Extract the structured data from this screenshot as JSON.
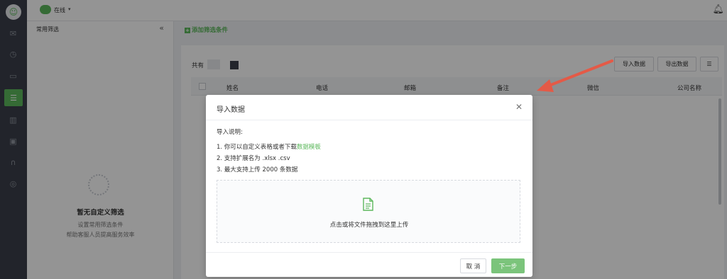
{
  "topbar": {
    "status": "在线"
  },
  "filter_panel": {
    "title": "常用筛选",
    "collapse_glyph": "«",
    "empty_title": "暂无自定义筛选",
    "empty_sub_1": "设置常用筛选条件",
    "empty_sub_2": "帮助客服人员提高服务效率"
  },
  "toolbar": {
    "add_filter": "添加筛选条件"
  },
  "content": {
    "total_label": "共有",
    "import_button": "导入数据",
    "export_button": "导出数据",
    "columns": [
      "姓名",
      "电话",
      "邮箱",
      "备注",
      "微信",
      "公司名称"
    ]
  },
  "modal": {
    "title": "导入数据",
    "instructions_heading": "导入说明:",
    "line1_prefix": "1. 你可以自定义表格或者下载",
    "line1_link": "数据模板",
    "line2": "2. 支持扩展名为 .xlsx .csv",
    "line3": "3. 最大支持上传 2000 条数据",
    "drop_text": "点击或将文件拖拽到这里上传",
    "cancel": "取 消",
    "next": "下一步"
  },
  "colors": {
    "accent": "#5cb85c",
    "arrow": "#e45a47",
    "rail": "#3b3f4a"
  },
  "icons": {
    "rail": [
      "chat-icon",
      "history-icon",
      "monitor-icon",
      "contacts-icon",
      "stats-icon",
      "ticket-icon",
      "headset-icon",
      "target-icon"
    ],
    "topbar": [
      "bell-icon"
    ]
  }
}
